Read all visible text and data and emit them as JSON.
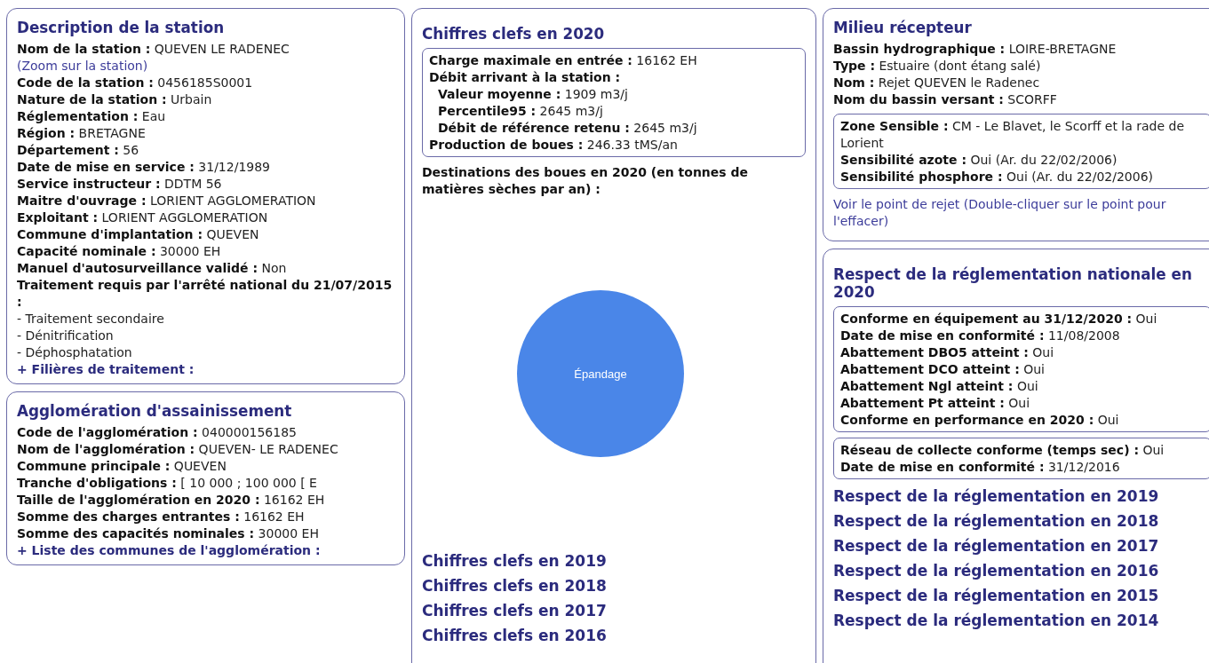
{
  "station": {
    "title": "Description de la station",
    "fields": [
      {
        "label": "Nom de la station :",
        "value": "QUEVEN LE RADENEC",
        "link": "(Zoom sur la station)"
      },
      {
        "label": "Code de la station :",
        "value": "0456185S0001"
      },
      {
        "label": "Nature de la station :",
        "value": "Urbain"
      },
      {
        "label": "Réglementation :",
        "value": "Eau"
      },
      {
        "label": "Région :",
        "value": "BRETAGNE"
      },
      {
        "label": "Département :",
        "value": "56"
      },
      {
        "label": "Date de mise en service :",
        "value": "31/12/1989"
      },
      {
        "label": "Service instructeur :",
        "value": "DDTM 56"
      },
      {
        "label": "Maitre d'ouvrage :",
        "value": "LORIENT AGGLOMERATION"
      },
      {
        "label": "Exploitant :",
        "value": "LORIENT AGGLOMERATION"
      },
      {
        "label": "Commune d'implantation :",
        "value": "QUEVEN"
      },
      {
        "label": "Capacité nominale :",
        "value": "30000 EH"
      },
      {
        "label": "Manuel d'autosurveillance validé :",
        "value": "Non"
      },
      {
        "label": "Traitement requis par l'arrêté national du 21/07/2015  :"
      }
    ],
    "treatments": [
      "- Traitement secondaire",
      "- Dénitrification",
      "- Déphosphatation"
    ],
    "expander": "+ Filières de traitement :"
  },
  "agglomeration": {
    "title": "Agglomération d'assainissement",
    "fields": [
      {
        "label": "Code de l'agglomération :",
        "value": "040000156185"
      },
      {
        "label": "Nom de l'agglomération :",
        "value": "QUEVEN- LE RADENEC"
      },
      {
        "label": "Commune principale :",
        "value": "QUEVEN"
      },
      {
        "label": "Tranche d'obligations :",
        "value": "[ 10 000 ; 100 000 [ E"
      },
      {
        "label": "Taille de l'agglomération en 2020 :",
        "value": "16162 EH"
      },
      {
        "label": "Somme des charges entrantes :",
        "value": "16162 EH"
      },
      {
        "label": "Somme des capacités nominales :",
        "value": "30000 EH"
      }
    ],
    "expander": "+ Liste des communes de l'agglomération :"
  },
  "key_figures": {
    "title": "Chiffres clefs en 2020",
    "fields": [
      {
        "label": "Charge maximale en entrée  :",
        "value": "16162 EH",
        "kind": "main"
      },
      {
        "label": "Débit arrivant à la station :",
        "kind": "main"
      },
      {
        "label": "Valeur moyenne :",
        "value": "1909 m3/j",
        "kind": "sub"
      },
      {
        "label": "Percentile95 :",
        "value": "2645 m3/j",
        "kind": "sub"
      },
      {
        "label": "Débit de référence retenu :",
        "value": "2645 m3/j",
        "kind": "sub"
      },
      {
        "label": "Production de boues :",
        "value": "246.33 tMS/an",
        "kind": "main"
      }
    ],
    "sludge_heading": "Destinations des boues en 2020 (en tonnes de matières sèches par an) :",
    "sludge_chart": {
      "slices": [
        {
          "label": "Épandage",
          "color": "#4a86e8"
        }
      ]
    },
    "other_years": [
      "Chiffres clefs en 2019",
      "Chiffres clefs en 2018",
      "Chiffres clefs en 2017",
      "Chiffres clefs en 2016"
    ]
  },
  "receiving_environment": {
    "title": "Milieu récepteur",
    "fields": [
      {
        "label": "Bassin hydrographique :",
        "value": "LOIRE-BRETAGNE"
      },
      {
        "label": "Type :",
        "value": "Estuaire (dont étang salé)"
      },
      {
        "label": "Nom :",
        "value": "Rejet QUEVEN le Radenec"
      },
      {
        "label": "Nom du bassin versant :",
        "value": "SCORFF"
      }
    ],
    "sensitive_zone": [
      {
        "label": "Zone Sensible :",
        "value": "CM - Le Blavet, le Scorff et la rade de Lorient"
      },
      {
        "label": "Sensibilité azote :",
        "value": "Oui (Ar. du 22/02/2006)"
      },
      {
        "label": "Sensibilité phosphore :",
        "value": "Oui (Ar. du 22/02/2006)"
      }
    ],
    "map_link": "Voir le point de rejet (Double-cliquer sur le point pour l'effacer)"
  },
  "compliance": {
    "title": "Respect de la réglementation nationale en 2020",
    "treatment": [
      {
        "label": "Conforme en équipement au 31/12/2020 :",
        "value": "Oui"
      },
      {
        "label": "Date de mise en conformité :",
        "value": "11/08/2008"
      },
      {
        "label": "Abattement DBO5 atteint :",
        "value": "Oui"
      },
      {
        "label": "Abattement DCO atteint :",
        "value": "Oui"
      },
      {
        "label": "Abattement Ngl atteint :",
        "value": "Oui"
      },
      {
        "label": "Abattement Pt atteint :",
        "value": "Oui"
      },
      {
        "label": "Conforme en performance en 2020 :",
        "value": "Oui"
      }
    ],
    "network": [
      {
        "label": "Réseau de collecte conforme (temps sec) :",
        "value": "Oui"
      },
      {
        "label": "Date de mise en conformité :",
        "value": "31/12/2016"
      }
    ],
    "other_years": [
      "Respect de la réglementation en 2019",
      "Respect de la réglementation en 2018",
      "Respect de la réglementation en 2017",
      "Respect de la réglementation en 2016",
      "Respect de la réglementation en 2015",
      "Respect de la réglementation en 2014"
    ]
  }
}
